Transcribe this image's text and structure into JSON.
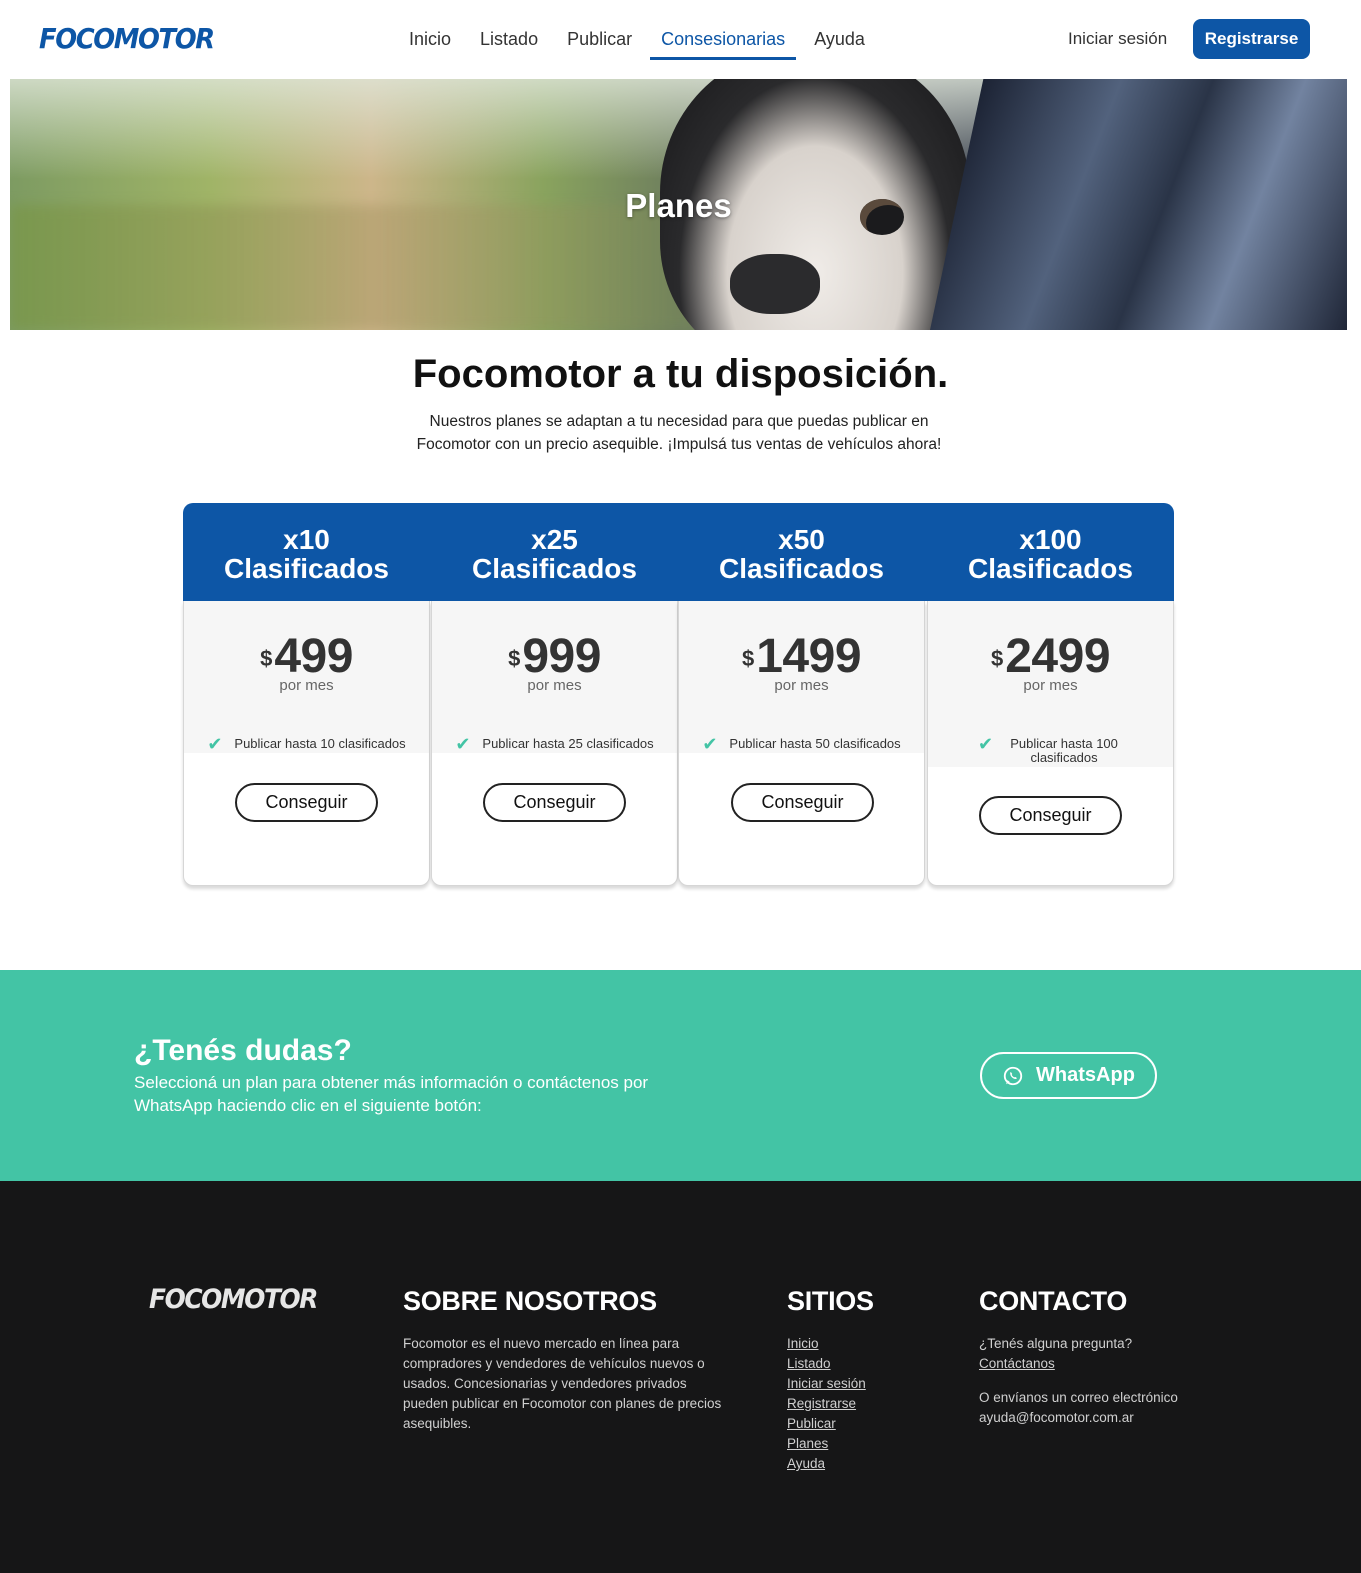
{
  "brand": {
    "logo_text": "FOCOMOTOR",
    "primary_color": "#0d56a6",
    "accent_color": "#43c4a5",
    "footer_bg": "#161617"
  },
  "nav": {
    "items": [
      {
        "label": "Inicio"
      },
      {
        "label": "Listado"
      },
      {
        "label": "Publicar"
      },
      {
        "label": "Consesionarias",
        "active": true
      },
      {
        "label": "Ayuda"
      }
    ],
    "login_label": "Iniciar sesión",
    "register_label": "Registrarse"
  },
  "hero": {
    "title": "Planes"
  },
  "intro": {
    "title": "Focomotor a tu disposición.",
    "text": "Nuestros planes se adaptan a tu necesidad para que puedas publicar en Focomotor con un precio asequible. ¡Impulsá tus ventas de vehículos ahora!"
  },
  "plans": [
    {
      "quantity": "x10",
      "unit": "Clasificados",
      "currency": "$",
      "price": "499",
      "period": "por mes",
      "feature": "Publicar hasta 10 clasificados",
      "cta": "Conseguir"
    },
    {
      "quantity": "x25",
      "unit": "Clasificados",
      "currency": "$",
      "price": "999",
      "period": "por mes",
      "feature": "Publicar hasta 25 clasificados",
      "cta": "Conseguir"
    },
    {
      "quantity": "x50",
      "unit": "Clasificados",
      "currency": "$",
      "price": "1499",
      "period": "por mes",
      "feature": "Publicar hasta 50 clasificados",
      "cta": "Conseguir"
    },
    {
      "quantity": "x100",
      "unit": "Clasificados",
      "currency": "$",
      "price": "2499",
      "period": "por mes",
      "feature": "Publicar hasta 100 clasificados",
      "cta": "Conseguir"
    }
  ],
  "cta": {
    "title": "¿Tenés dudas?",
    "text": "Seleccioná un plan para obtener más información o contáctenos por WhatsApp haciendo clic en el siguiente botón:",
    "button_label": "WhatsApp",
    "button_icon": "whatsapp-icon"
  },
  "footer": {
    "logo_text": "FOCOMOTOR",
    "about_heading": "SOBRE NOSOTROS",
    "about_text": "Focomotor es el nuevo mercado en línea para compradores y vendedores de vehículos nuevos o usados. Concesionarias y vendedores privados pueden publicar en Focomotor con planes de precios asequibles.",
    "sites_heading": "SITIOS",
    "sites": [
      "Inicio",
      "Listado",
      "Iniciar sesión",
      "Registrarse",
      "Publicar",
      "Planes",
      "Ayuda"
    ],
    "contact_heading": "CONTACTO",
    "contact_question": "¿Tenés alguna pregunta?",
    "contact_link": "Contáctanos",
    "contact_email_text": "O envíanos un correo electrónico",
    "contact_email": "ayuda@focomotor.com.ar"
  }
}
